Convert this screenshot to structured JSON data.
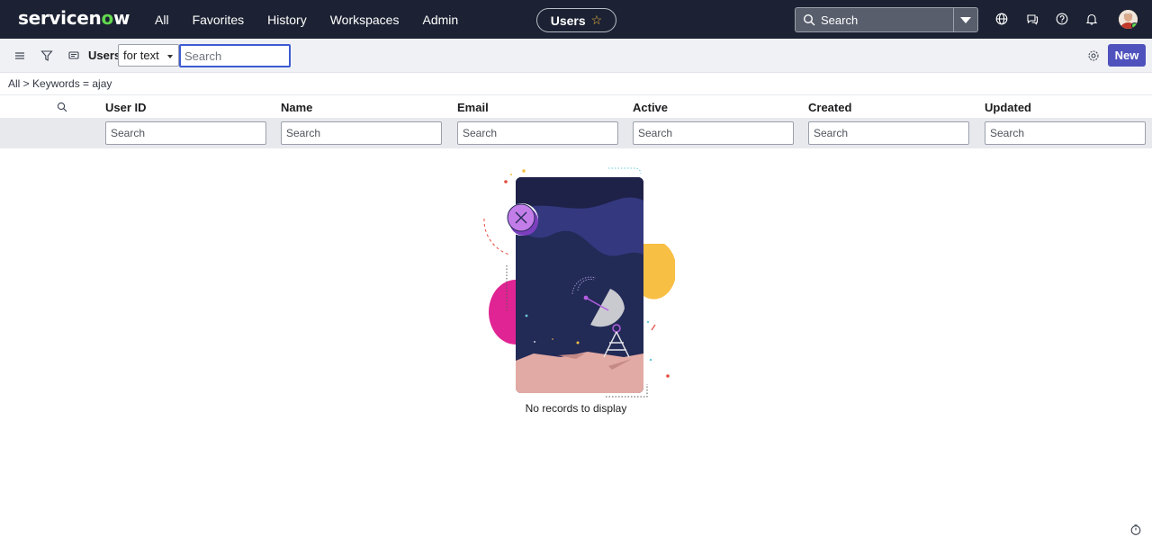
{
  "header": {
    "logo_prefix": "servicen",
    "logo_o": "o",
    "logo_suffix": "w",
    "menu": [
      "All",
      "Favorites",
      "History",
      "Workspaces",
      "Admin"
    ],
    "context_title": "Users",
    "search_placeholder": "Search",
    "icons": [
      "globe-icon",
      "chat-icon",
      "help-icon",
      "bell-icon"
    ]
  },
  "toolbar": {
    "title": "Users",
    "search_field": "for text",
    "search_placeholder": "Search",
    "new_label": "New"
  },
  "breadcrumb": "All > Keywords = ajay",
  "table": {
    "columns": [
      "User ID",
      "Name",
      "Email",
      "Active",
      "Created",
      "Updated"
    ],
    "filter_placeholder": "Search"
  },
  "empty_state": "No records to display",
  "colors": {
    "nav_bg": "#1c2233",
    "accent": "#4f52bd",
    "logo_o": "#62d84e",
    "focus": "#3d5bd4"
  }
}
